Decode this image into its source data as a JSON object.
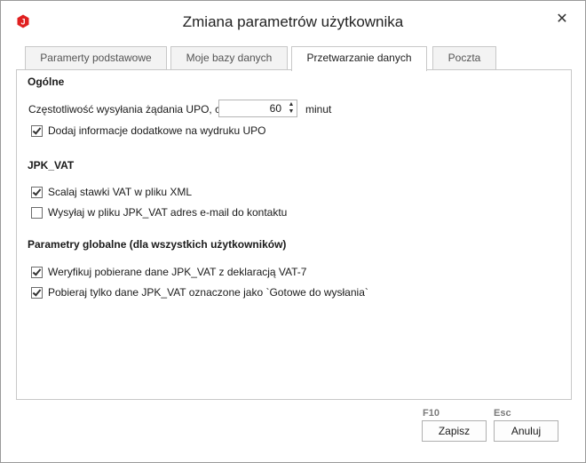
{
  "window": {
    "title": "Zmiana parametrów użytkownika",
    "app_icon_letter": "J",
    "accent": "#e02020"
  },
  "tabs": [
    {
      "label": "Paramerty podstawowe"
    },
    {
      "label": "Moje bazy danych"
    },
    {
      "label": "Przetwarzanie danych",
      "active": true
    },
    {
      "label": "Poczta"
    }
  ],
  "general": {
    "heading": "Ogólne",
    "upo_freq_label": "Częstotliwość wysyłania żądania UPO, co",
    "upo_freq_value": "60",
    "upo_freq_unit": "minut",
    "extra_info": {
      "label": "Dodaj informacje dodatkowe na wydruku UPO",
      "checked": true
    }
  },
  "jpk": {
    "heading": "JPK_VAT",
    "merge_rates": {
      "label": "Scalaj stawki VAT w pliku XML",
      "checked": true
    },
    "send_email": {
      "label": "Wysyłaj w pliku JPK_VAT adres e-mail do kontaktu",
      "checked": false
    }
  },
  "global": {
    "heading": "Parametry globalne (dla wszystkich użytkowników)",
    "verify": {
      "label": "Weryfikuj pobierane dane JPK_VAT z deklaracją VAT-7",
      "checked": true
    },
    "only_ready": {
      "label": "Pobieraj tylko dane JPK_VAT oznaczone jako `Gotowe do wysłania`",
      "checked": true
    }
  },
  "footer": {
    "save_hotkey": "F10",
    "save_label": "Zapisz",
    "cancel_hotkey": "Esc",
    "cancel_label": "Anuluj"
  }
}
